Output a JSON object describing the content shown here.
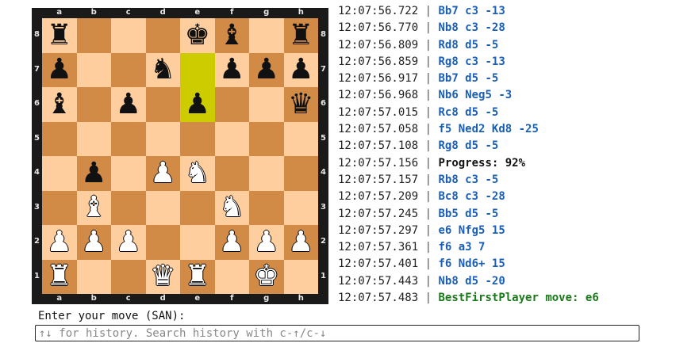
{
  "board": {
    "files": [
      "a",
      "b",
      "c",
      "d",
      "e",
      "f",
      "g",
      "h"
    ],
    "ranks": [
      "8",
      "7",
      "6",
      "5",
      "4",
      "3",
      "2",
      "1"
    ],
    "highlight": [
      "e7",
      "e6"
    ],
    "pieces": [
      {
        "sq": "a8",
        "glyph": "♚",
        "name": "black-rook",
        "color": "b",
        "g": "♜"
      },
      {
        "sq": "e8",
        "glyph": "♚",
        "name": "black-king",
        "color": "b"
      },
      {
        "sq": "f8",
        "glyph": "♝",
        "name": "black-bishop",
        "color": "b"
      },
      {
        "sq": "h8",
        "glyph": "♜",
        "name": "black-rook",
        "color": "b"
      },
      {
        "sq": "a7",
        "glyph": "♟",
        "name": "black-pawn",
        "color": "b"
      },
      {
        "sq": "d7",
        "glyph": "♞",
        "name": "black-knight",
        "color": "b"
      },
      {
        "sq": "f7",
        "glyph": "♟",
        "name": "black-pawn",
        "color": "b"
      },
      {
        "sq": "g7",
        "glyph": "♟",
        "name": "black-pawn",
        "color": "b"
      },
      {
        "sq": "h7",
        "glyph": "♟",
        "name": "black-pawn",
        "color": "b"
      },
      {
        "sq": "a6",
        "glyph": "♝",
        "name": "black-bishop",
        "color": "b"
      },
      {
        "sq": "c6",
        "glyph": "♟",
        "name": "black-pawn",
        "color": "b"
      },
      {
        "sq": "e6",
        "glyph": "♟",
        "name": "black-pawn",
        "color": "b"
      },
      {
        "sq": "h6",
        "glyph": "♛",
        "name": "black-queen",
        "color": "b"
      },
      {
        "sq": "b4",
        "glyph": "♟",
        "name": "black-pawn",
        "color": "b"
      },
      {
        "sq": "d4",
        "glyph": "♟",
        "name": "white-pawn",
        "color": "w"
      },
      {
        "sq": "e4",
        "glyph": "♞",
        "name": "white-knight",
        "color": "w"
      },
      {
        "sq": "b3",
        "glyph": "♝",
        "name": "white-bishop",
        "color": "w"
      },
      {
        "sq": "f3",
        "glyph": "♞",
        "name": "white-knight",
        "color": "w"
      },
      {
        "sq": "a2",
        "glyph": "♟",
        "name": "white-pawn",
        "color": "w"
      },
      {
        "sq": "b2",
        "glyph": "♟",
        "name": "white-pawn",
        "color": "w"
      },
      {
        "sq": "c2",
        "glyph": "♟",
        "name": "white-pawn",
        "color": "w"
      },
      {
        "sq": "f2",
        "glyph": "♟",
        "name": "white-pawn",
        "color": "w"
      },
      {
        "sq": "g2",
        "glyph": "♟",
        "name": "white-pawn",
        "color": "w"
      },
      {
        "sq": "h2",
        "glyph": "♟",
        "name": "white-pawn",
        "color": "w"
      },
      {
        "sq": "a1",
        "glyph": "♜",
        "name": "white-rook",
        "color": "w"
      },
      {
        "sq": "d1",
        "glyph": "♛",
        "name": "white-queen",
        "color": "w"
      },
      {
        "sq": "e1",
        "glyph": "♜",
        "name": "white-rook",
        "color": "w"
      },
      {
        "sq": "g1",
        "glyph": "♚",
        "name": "white-king",
        "color": "w"
      }
    ]
  },
  "log": [
    {
      "time": "12:07:56.722",
      "text": "Bb7 c3 -13",
      "style": "blue"
    },
    {
      "time": "12:07:56.770",
      "text": "Nb8 c3 -28",
      "style": "blue"
    },
    {
      "time": "12:07:56.809",
      "text": "Rd8 d5 -5",
      "style": "blue"
    },
    {
      "time": "12:07:56.859",
      "text": "Rg8 c3 -13",
      "style": "blue"
    },
    {
      "time": "12:07:56.917",
      "text": "Bb7 d5 -5",
      "style": "blue"
    },
    {
      "time": "12:07:56.968",
      "text": "Nb6 Neg5 -3",
      "style": "blue"
    },
    {
      "time": "12:07:57.015",
      "text": "Rc8 d5 -5",
      "style": "blue"
    },
    {
      "time": "12:07:57.058",
      "text": "f5 Ned2 Kd8 -25",
      "style": "blue"
    },
    {
      "time": "12:07:57.108",
      "text": "Rg8 d5 -5",
      "style": "blue"
    },
    {
      "time": "12:07:57.156",
      "text": "Progress: 92%",
      "style": "black"
    },
    {
      "time": "12:07:57.157",
      "text": "Rb8 c3 -5",
      "style": "blue"
    },
    {
      "time": "12:07:57.209",
      "text": "Bc8 c3 -28",
      "style": "blue"
    },
    {
      "time": "12:07:57.245",
      "text": "Bb5 d5 -5",
      "style": "blue"
    },
    {
      "time": "12:07:57.297",
      "text": "e6 Nfg5 15",
      "style": "blue"
    },
    {
      "time": "12:07:57.361",
      "text": "f6 a3 7",
      "style": "blue"
    },
    {
      "time": "12:07:57.401",
      "text": "f6 Nd6+ 15",
      "style": "blue"
    },
    {
      "time": "12:07:57.443",
      "text": "Nb8 d5 -20",
      "style": "blue"
    },
    {
      "time": "12:07:57.483",
      "text": "BestFirstPlayer move: e6",
      "style": "green"
    }
  ],
  "separator": "|",
  "prompt": {
    "label": "Enter your move (SAN):",
    "placeholder": "↑↓ for history. Search history with c-↑/c-↓",
    "value": ""
  },
  "colors": {
    "light_square": "#ffce9e",
    "dark_square": "#d18b47",
    "highlight": "#cccc00",
    "move_text": "#1a5fb4",
    "final_move_text": "#1a7a1a"
  }
}
